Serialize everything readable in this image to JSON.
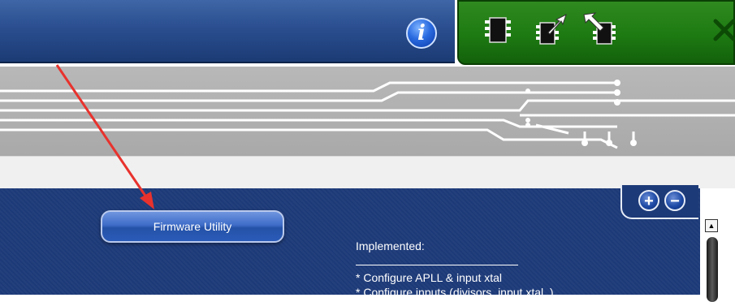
{
  "toolbar": {
    "info_label": "i",
    "chip_buttons": [
      "chip-read-icon",
      "chip-write-icon",
      "chip-verify-icon"
    ],
    "close_icon": "close-icon"
  },
  "main": {
    "firmware_button_label": "Firmware Utility",
    "zoom_in_label": "+",
    "zoom_out_label": "−"
  },
  "notes": {
    "heading": "Implemented:",
    "lines": [
      "* Configure APLL & input xtal",
      "* Configure inputs (divisors, input xtal..)"
    ]
  },
  "scrollbar": {
    "up_label": "▲"
  },
  "annotation": {
    "color": "#e8322d"
  },
  "colors": {
    "title_bar": "#2a4e8f",
    "toolbar_green": "#1d7a12",
    "panel_blue": "#1d3a78",
    "pcb_gray": "#b0b0b0"
  }
}
